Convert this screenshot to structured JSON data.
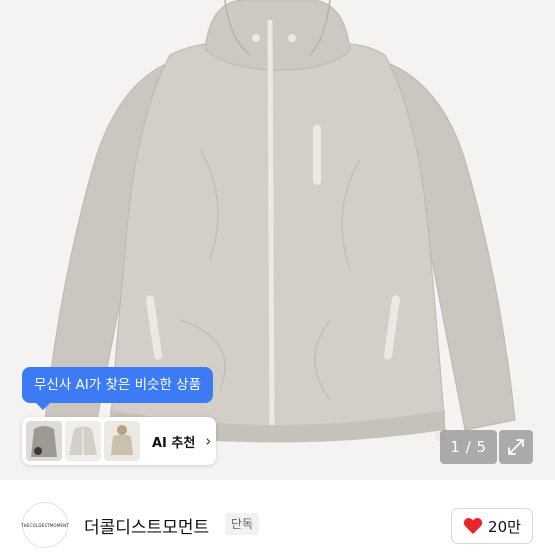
{
  "product_image": {
    "alt_icon": "hooded-windbreaker-jacket-photo"
  },
  "ai_recommend": {
    "tooltip": "무신사 AI가 찾은 비슷한 상품",
    "label": "AI 추천",
    "chevron": "›"
  },
  "gallery": {
    "counter": "1 / 5",
    "expand_icon": "expand-icon"
  },
  "brand": {
    "logo_text": "THECOLDESTMOMENT",
    "name": "더콜디스트모먼트",
    "tag": "단독"
  },
  "like": {
    "count": "20만",
    "color": "#e8262a"
  },
  "colors": {
    "accent": "#3d7bf5",
    "jacket": "#cfcbc4"
  }
}
